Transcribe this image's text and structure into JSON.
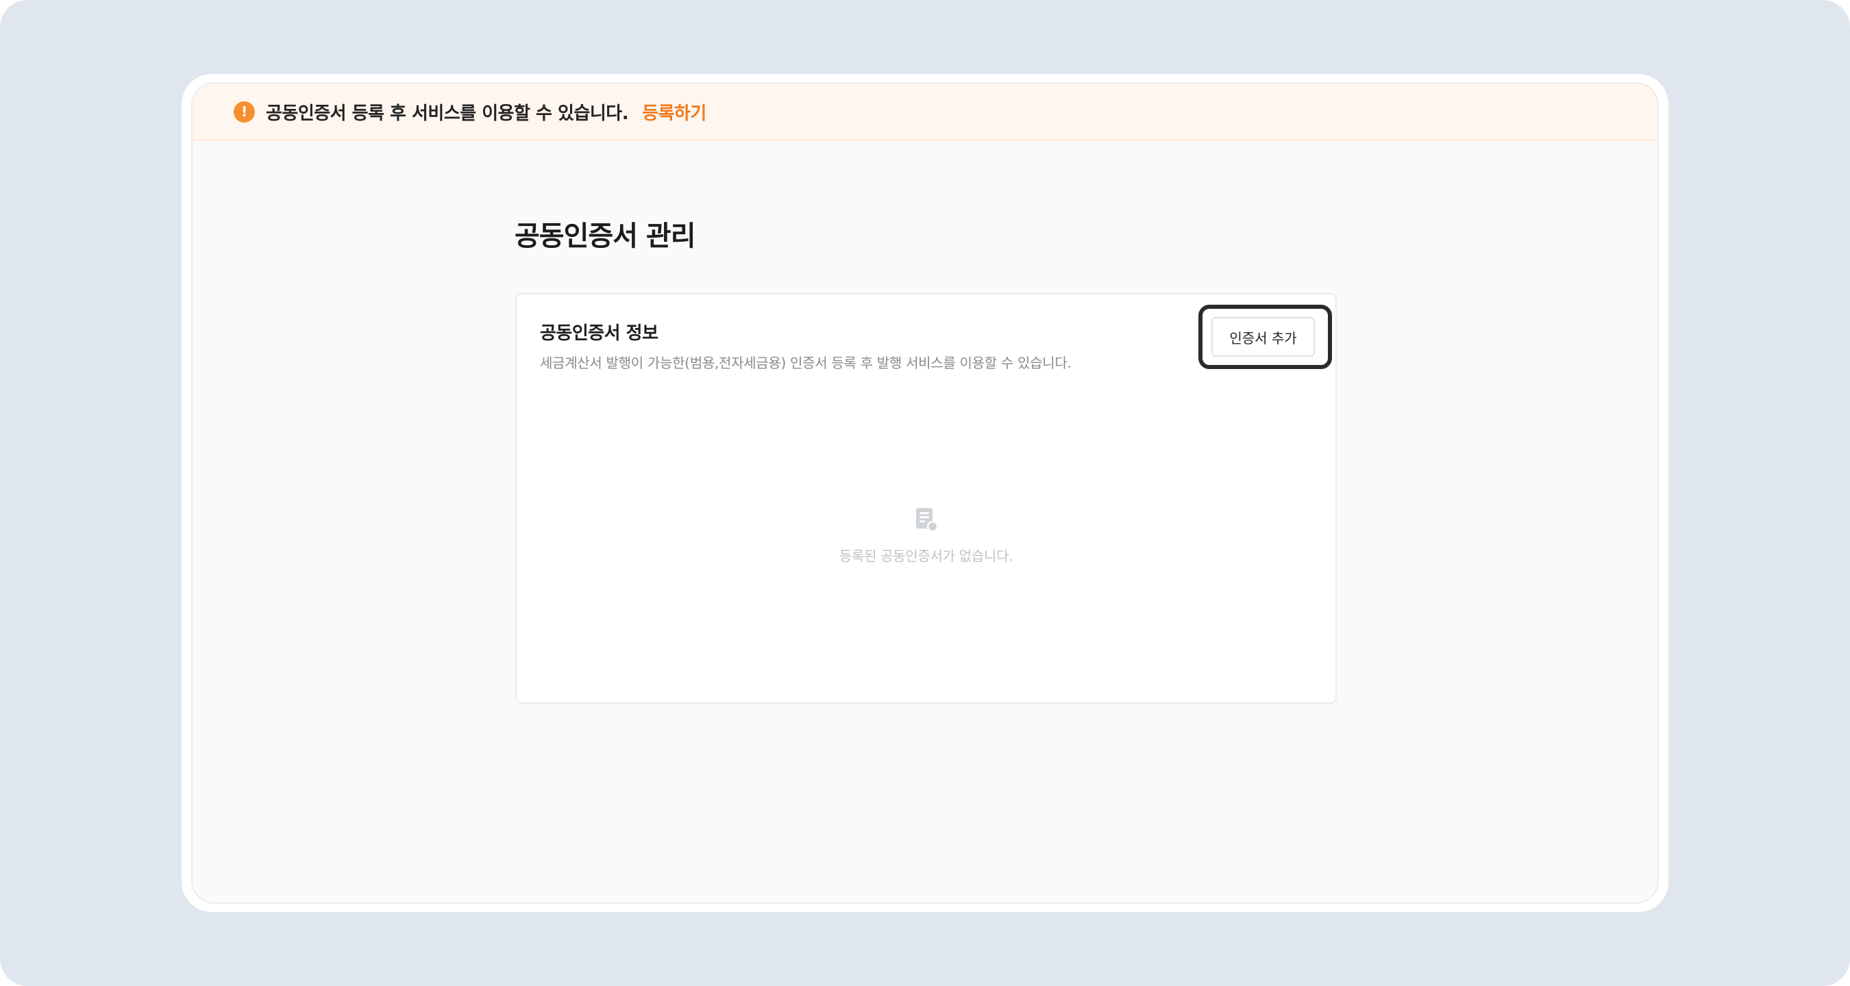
{
  "banner": {
    "message": "공동인증서 등록 후 서비스를 이용할 수 있습니다.",
    "link_label": "등록하기",
    "icon": "warning-icon",
    "accent_color": "#f5902f"
  },
  "page": {
    "title": "공동인증서 관리"
  },
  "card": {
    "title": "공동인증서 정보",
    "description": "세금계산서 발행이 가능한(범용,전자세금용) 인증서 등록 후 발행 서비스를 이용할 수 있습니다.",
    "add_button_label": "인증서  추가",
    "empty_icon": "document-icon",
    "empty_message": "등록된 공동인증서가 없습니다."
  }
}
